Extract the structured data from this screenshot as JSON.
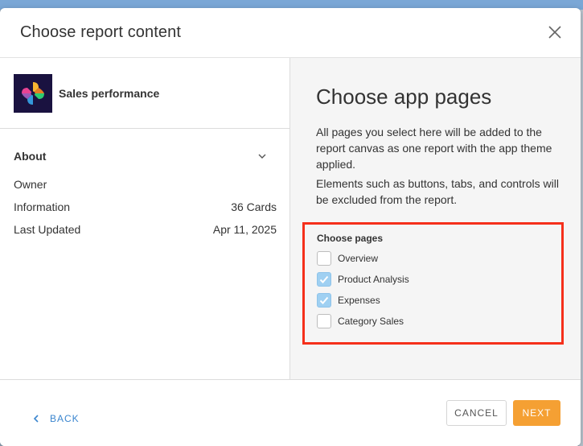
{
  "dialog": {
    "title": "Choose report content",
    "close_icon": "close-icon"
  },
  "app": {
    "name": "Sales performance",
    "logo_icon": "pinwheel-logo"
  },
  "about": {
    "header": "About",
    "rows": [
      {
        "label": "Owner",
        "value": ""
      },
      {
        "label": "Information",
        "value": "36 Cards"
      },
      {
        "label": "Last Updated",
        "value": "Apr 11, 2025"
      }
    ]
  },
  "pages_panel": {
    "title": "Choose app pages",
    "description_1": "All pages you select here will be added to the report canvas as one report with the app theme applied.",
    "description_2": "Elements such as buttons, tabs, and controls will be excluded from the report.",
    "choose_label": "Choose pages",
    "pages": [
      {
        "label": "Overview",
        "checked": false
      },
      {
        "label": "Product Analysis",
        "checked": true
      },
      {
        "label": "Expenses",
        "checked": true
      },
      {
        "label": "Category Sales",
        "checked": false
      }
    ]
  },
  "footer": {
    "back_label": "BACK",
    "cancel_label": "CANCEL",
    "next_label": "NEXT"
  },
  "colors": {
    "accent_blue": "#3b86cf",
    "next_orange": "#f5a033",
    "highlight_red": "#f5301b",
    "checkbox_checked": "#9fd0f2"
  }
}
